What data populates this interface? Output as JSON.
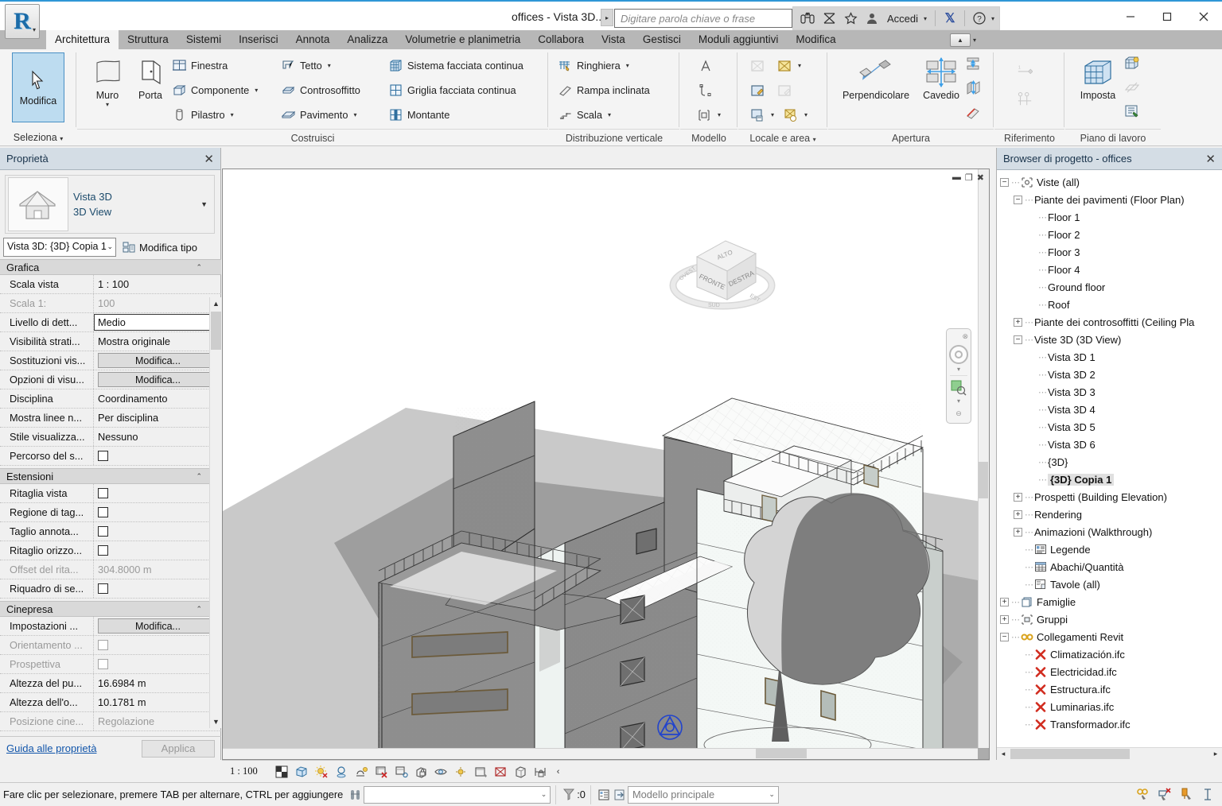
{
  "titlebar": {
    "document_title": "offices - Vista 3D...",
    "search_placeholder": "Digitare parola chiave o frase",
    "sign_in_label": "Accedi",
    "icons": [
      "binoculars-icon",
      "subscription-icon",
      "star-icon",
      "user-icon",
      "exchange-icon",
      "help-icon"
    ],
    "window_buttons": [
      "minimize",
      "maximize",
      "close"
    ],
    "app_glyph": "R"
  },
  "ribbon": {
    "tabs": [
      {
        "label": "Architettura",
        "active": true
      },
      {
        "label": "Struttura",
        "active": false
      },
      {
        "label": "Sistemi",
        "active": false
      },
      {
        "label": "Inserisci",
        "active": false
      },
      {
        "label": "Annota",
        "active": false
      },
      {
        "label": "Analizza",
        "active": false
      },
      {
        "label": "Volumetrie e planimetria",
        "active": false
      },
      {
        "label": "Collabora",
        "active": false
      },
      {
        "label": "Vista",
        "active": false
      },
      {
        "label": "Gestisci",
        "active": false
      },
      {
        "label": "Moduli aggiuntivi",
        "active": false
      },
      {
        "label": "Modifica",
        "active": false
      }
    ],
    "select_panel": {
      "modifica_label": "Modifica",
      "panel_title": "Seleziona"
    },
    "build_panel": {
      "panel_title": "Costruisci",
      "big_buttons": [
        {
          "label": "Muro",
          "has_dropdown": true,
          "icon": "wall-icon"
        },
        {
          "label": "Porta",
          "has_dropdown": false,
          "icon": "door-icon"
        }
      ],
      "column1": [
        {
          "label": "Finestra",
          "icon": "window-icon",
          "has_dropdown": false
        },
        {
          "label": "Componente",
          "icon": "component-icon",
          "has_dropdown": true
        },
        {
          "label": "Pilastro",
          "icon": "column-icon",
          "has_dropdown": true
        }
      ],
      "column2": [
        {
          "label": "Tetto",
          "icon": "roof-icon",
          "has_dropdown": true
        },
        {
          "label": "Controsoffitto",
          "icon": "ceiling-icon",
          "has_dropdown": false
        },
        {
          "label": "Pavimento",
          "icon": "floor-icon",
          "has_dropdown": true
        }
      ],
      "column3": [
        {
          "label": "Sistema facciata continua",
          "icon": "curtain-system-icon",
          "has_dropdown": false
        },
        {
          "label": "Griglia facciata continua",
          "icon": "curtain-grid-icon",
          "has_dropdown": false
        },
        {
          "label": "Montante",
          "icon": "mullion-icon",
          "has_dropdown": false
        }
      ]
    },
    "circulation_panel": {
      "panel_title": "Distribuzione verticale",
      "items": [
        {
          "label": "Ringhiera",
          "icon": "railing-icon",
          "has_dropdown": true
        },
        {
          "label": "Rampa inclinata",
          "icon": "ramp-icon",
          "has_dropdown": false
        },
        {
          "label": "Scala",
          "icon": "stair-icon",
          "has_dropdown": true
        }
      ]
    },
    "model_panel": {
      "panel_title": "Modello",
      "items": [
        "model-text-icon",
        "model-line-icon",
        "model-group-icon"
      ]
    },
    "room_area_panel": {
      "panel_title": "Locale e area",
      "has_dropdown": true,
      "items": [
        "room-icon",
        "area-icon",
        "room-tag-icon",
        "area-tag-icon",
        "room-separator-icon",
        "area-boundary-icon"
      ]
    },
    "opening_panel": {
      "panel_title": "Apertura",
      "big_buttons": [
        {
          "label": "Perpendicolare",
          "icon": "by-face-opening-icon"
        },
        {
          "label": "Cavedio",
          "icon": "shaft-opening-icon"
        }
      ],
      "small_items": [
        "wall-opening-icon",
        "vertical-opening-icon",
        "dormer-opening-icon"
      ]
    },
    "datum_panel": {
      "panel_title": "Riferimento",
      "items": [
        "level-icon",
        "grid-icon"
      ]
    },
    "workplane_panel": {
      "panel_title": "Piano di lavoro",
      "big_buttons": [
        {
          "label": "Imposta",
          "icon": "set-workplane-icon"
        }
      ],
      "small_items": [
        "show-workplane-icon",
        "ref-plane-icon",
        "viewer-icon"
      ]
    },
    "minimize_ribbon_icon": "ribbon-collapse-icon"
  },
  "properties": {
    "title": "Proprietà",
    "close_icon": "close-icon",
    "type_name": "Vista 3D",
    "type_category": "3D View",
    "type_selector_value": "Vista 3D: {3D} Copia 1",
    "edit_type_label": "Modifica tipo",
    "sections": [
      {
        "name": "Grafica",
        "rows": [
          {
            "key": "Scala vista",
            "value": "1 : 100",
            "type": "text"
          },
          {
            "key": "Scala  1:",
            "value": "100",
            "type": "text",
            "dim": true
          },
          {
            "key": "Livello di dett...",
            "value": "Medio",
            "type": "boxed"
          },
          {
            "key": "Visibilità strati...",
            "value": "Mostra originale",
            "type": "text"
          },
          {
            "key": "Sostituzioni vis...",
            "value": "Modifica...",
            "type": "button"
          },
          {
            "key": "Opzioni di visu...",
            "value": "Modifica...",
            "type": "button"
          },
          {
            "key": "Disciplina",
            "value": "Coordinamento",
            "type": "text"
          },
          {
            "key": "Mostra linee n...",
            "value": "Per disciplina",
            "type": "text"
          },
          {
            "key": "Stile visualizza...",
            "value": "Nessuno",
            "type": "text"
          },
          {
            "key": "Percorso del s...",
            "value": "",
            "type": "checkbox"
          }
        ]
      },
      {
        "name": "Estensioni",
        "rows": [
          {
            "key": "Ritaglia vista",
            "value": "",
            "type": "checkbox"
          },
          {
            "key": "Regione di tag...",
            "value": "",
            "type": "checkbox"
          },
          {
            "key": "Taglio annota...",
            "value": "",
            "type": "checkbox"
          },
          {
            "key": "Ritaglio orizzo...",
            "value": "",
            "type": "checkbox"
          },
          {
            "key": "Offset del rita...",
            "value": "304.8000 m",
            "type": "text",
            "dim": true
          },
          {
            "key": "Riquadro di se...",
            "value": "",
            "type": "checkbox"
          }
        ]
      },
      {
        "name": "Cinepresa",
        "rows": [
          {
            "key": "Impostazioni ...",
            "value": "Modifica...",
            "type": "button"
          },
          {
            "key": "Orientamento ...",
            "value": "",
            "type": "checkbox",
            "dim": true
          },
          {
            "key": "Prospettiva",
            "value": "",
            "type": "checkbox",
            "dim": true
          },
          {
            "key": "Altezza del pu...",
            "value": "16.6984 m",
            "type": "text"
          },
          {
            "key": "Altezza dell'o...",
            "value": "10.1781 m",
            "type": "text"
          },
          {
            "key": "Posizione cine...",
            "value": "Regolazione",
            "type": "text",
            "dim": true
          }
        ]
      }
    ],
    "footer": {
      "guide_label": "Guida alle proprietà",
      "apply_label": "Applica"
    }
  },
  "viewport": {
    "window_controls": [
      "minimize",
      "restore",
      "close"
    ],
    "viewcube": {
      "top_face": "ALTO",
      "front_face": "FRONTE",
      "right_face": "DESTRA",
      "ring_labels": [
        "OVEST",
        "SUD",
        "EST"
      ]
    },
    "navbar": [
      "steering-wheel-icon",
      "zoom-region-icon"
    ],
    "model_description": "3D isometric view of a 5-storey concrete office building with railings, roof terraces, windows and a tree"
  },
  "view_control_bar": {
    "scale": "1 : 100",
    "icons": [
      "detail-level-icon",
      "visual-style-icon",
      "sun-path-icon",
      "shadows-icon",
      "rendering-dialog-icon",
      "crop-view-icon",
      "show-crop-icon",
      "lock-3d-view-icon",
      "temporary-hide-isolate-icon",
      "reveal-hidden-icon",
      "temporary-view-properties-icon",
      "analytical-model-icon",
      "constraints-icon",
      "measure-icon"
    ],
    "collapse_icon": "chevron-left-icon"
  },
  "browser": {
    "title": "Browser di progetto - offices",
    "close_icon": "close-icon",
    "tree": [
      {
        "label": "Viste (all)",
        "depth": 0,
        "expander": "-",
        "icon": "views-icon",
        "selected": false
      },
      {
        "label": "Piante dei pavimenti (Floor Plan)",
        "depth": 1,
        "expander": "-",
        "icon": "",
        "selected": false
      },
      {
        "label": "Floor 1",
        "depth": 2,
        "expander": "",
        "icon": "",
        "selected": false
      },
      {
        "label": "Floor 2",
        "depth": 2,
        "expander": "",
        "icon": "",
        "selected": false
      },
      {
        "label": "Floor 3",
        "depth": 2,
        "expander": "",
        "icon": "",
        "selected": false
      },
      {
        "label": "Floor 4",
        "depth": 2,
        "expander": "",
        "icon": "",
        "selected": false
      },
      {
        "label": "Ground floor",
        "depth": 2,
        "expander": "",
        "icon": "",
        "selected": false
      },
      {
        "label": "Roof",
        "depth": 2,
        "expander": "",
        "icon": "",
        "selected": false
      },
      {
        "label": "Piante dei controsoffitti (Ceiling Pla",
        "depth": 1,
        "expander": "+",
        "icon": "",
        "selected": false
      },
      {
        "label": "Viste 3D (3D View)",
        "depth": 1,
        "expander": "-",
        "icon": "",
        "selected": false
      },
      {
        "label": "Vista 3D 1",
        "depth": 2,
        "expander": "",
        "icon": "",
        "selected": false
      },
      {
        "label": "Vista 3D 2",
        "depth": 2,
        "expander": "",
        "icon": "",
        "selected": false
      },
      {
        "label": "Vista 3D 3",
        "depth": 2,
        "expander": "",
        "icon": "",
        "selected": false
      },
      {
        "label": "Vista 3D 4",
        "depth": 2,
        "expander": "",
        "icon": "",
        "selected": false
      },
      {
        "label": "Vista 3D 5",
        "depth": 2,
        "expander": "",
        "icon": "",
        "selected": false
      },
      {
        "label": "Vista 3D 6",
        "depth": 2,
        "expander": "",
        "icon": "",
        "selected": false
      },
      {
        "label": "{3D}",
        "depth": 2,
        "expander": "",
        "icon": "",
        "selected": false
      },
      {
        "label": "{3D} Copia 1",
        "depth": 2,
        "expander": "",
        "icon": "",
        "selected": true
      },
      {
        "label": "Prospetti (Building Elevation)",
        "depth": 1,
        "expander": "+",
        "icon": "",
        "selected": false
      },
      {
        "label": "Rendering",
        "depth": 1,
        "expander": "+",
        "icon": "",
        "selected": false
      },
      {
        "label": "Animazioni (Walkthrough)",
        "depth": 1,
        "expander": "+",
        "icon": "",
        "selected": false
      },
      {
        "label": "Legende",
        "depth": 1,
        "expander": "",
        "icon": "legend-icon",
        "selected": false
      },
      {
        "label": "Abachi/Quantità",
        "depth": 1,
        "expander": "",
        "icon": "schedule-icon",
        "selected": false
      },
      {
        "label": "Tavole (all)",
        "depth": 1,
        "expander": "",
        "icon": "sheet-icon",
        "selected": false
      },
      {
        "label": "Famiglie",
        "depth": 0,
        "expander": "+",
        "icon": "family-icon",
        "selected": false
      },
      {
        "label": "Gruppi",
        "depth": 0,
        "expander": "+",
        "icon": "group-icon",
        "selected": false
      },
      {
        "label": "Collegamenti Revit",
        "depth": 0,
        "expander": "-",
        "icon": "link-icon",
        "selected": false
      },
      {
        "label": "Climatización.ifc",
        "depth": 1,
        "expander": "",
        "icon": "broken-link-icon",
        "selected": false
      },
      {
        "label": "Electricidad.ifc",
        "depth": 1,
        "expander": "",
        "icon": "broken-link-icon",
        "selected": false
      },
      {
        "label": "Estructura.ifc",
        "depth": 1,
        "expander": "",
        "icon": "broken-link-icon",
        "selected": false
      },
      {
        "label": "Luminarias.ifc",
        "depth": 1,
        "expander": "",
        "icon": "broken-link-icon",
        "selected": false
      },
      {
        "label": "Transformador.ifc",
        "depth": 1,
        "expander": "",
        "icon": "broken-link-icon",
        "selected": false
      }
    ]
  },
  "statusbar": {
    "message": "Fare clic per selezionare, premere TAB per alternare, CTRL per aggiungere",
    "filter_count": ":0",
    "worksets_value": "Modello principale",
    "icons_left": [
      "press-pick-icon",
      "filter-icon",
      "worksets-icon",
      "design-options-icon"
    ],
    "icons_right": [
      "select-links-icon",
      "select-underlay-icon",
      "select-pinned-icon",
      "select-by-face-icon"
    ]
  },
  "colors": {
    "accent": "#2f97d6",
    "ribbon_tab_bar": "#b7b7b7",
    "palette_header": "#d4dde5",
    "selected_tab_bg": "#f4f4f4",
    "selection_highlight": "#e0e0e0",
    "broken_link_red": "#d12b1e",
    "link_blue": "#1155aa"
  }
}
